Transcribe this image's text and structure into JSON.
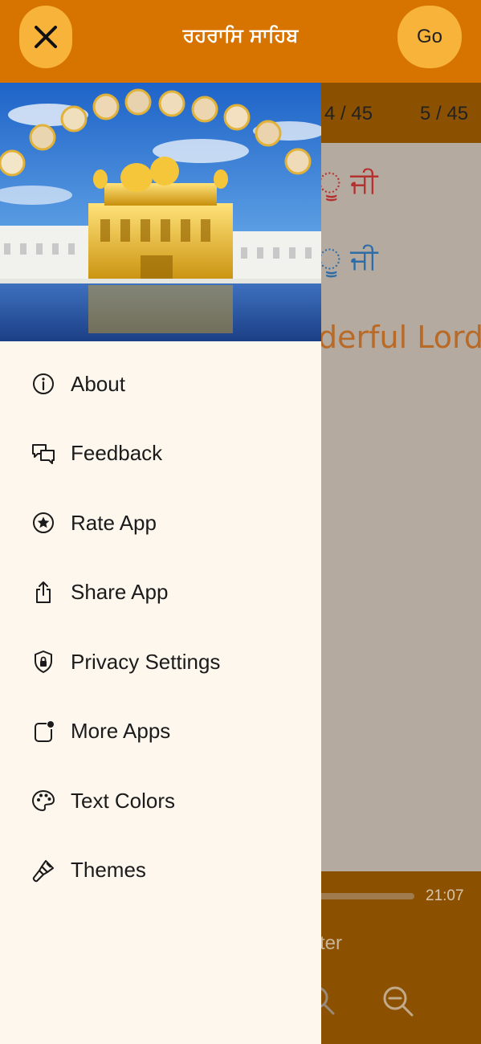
{
  "header": {
    "title": "ਰਹਰਾਸਿ ਸਾਹਿਬ",
    "go_label": "Go"
  },
  "background": {
    "page_indicators": [
      "4 / 45",
      "5 / 45"
    ],
    "lines": [
      "ੂ ਜੀ",
      "ੂ ਜੀ",
      "derful Lord"
    ],
    "time": "21:07",
    "filter_label": "ter"
  },
  "drawer": {
    "menu": [
      {
        "label": "About",
        "icon": "info-icon"
      },
      {
        "label": "Feedback",
        "icon": "feedback-icon"
      },
      {
        "label": "Rate App",
        "icon": "star-icon"
      },
      {
        "label": "Share App",
        "icon": "share-icon"
      },
      {
        "label": "Privacy Settings",
        "icon": "privacy-icon"
      },
      {
        "label": "More Apps",
        "icon": "more-apps-icon"
      },
      {
        "label": "Text Colors",
        "icon": "palette-icon"
      },
      {
        "label": "Themes",
        "icon": "brush-icon"
      }
    ]
  },
  "colors": {
    "app_bar": "#d77400",
    "button": "#f8b33a",
    "drawer_bg": "#fdf7ee"
  }
}
